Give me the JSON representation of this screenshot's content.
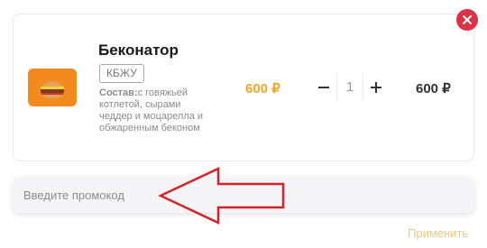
{
  "cart_item": {
    "name": "Беконатор",
    "kbju_label": "КБЖУ",
    "description_label": "Состав:",
    "description_text": "с говяжьей котлетой, сырами чеддер и моцарелла и обжаренным беконом",
    "unit_price": "600 ₽",
    "quantity": "1",
    "total_price": "600 ₽",
    "thumb_icon": "burger-image"
  },
  "promo": {
    "placeholder": "Введите промокод",
    "apply_label": "Применить"
  },
  "colors": {
    "accent": "#f5a623",
    "remove": "#dc3246",
    "annotation_arrow": "#d8222a"
  }
}
